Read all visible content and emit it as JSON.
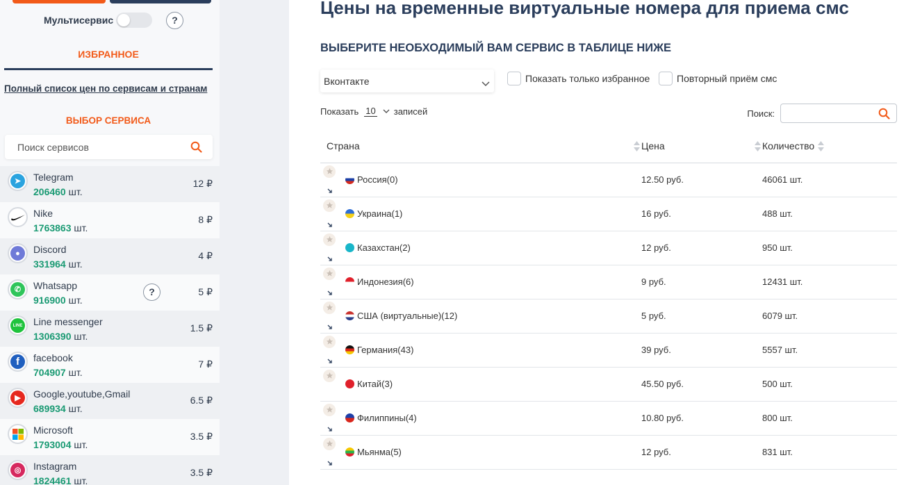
{
  "sidebar": {
    "multiservice_label": "Мультисервис",
    "help_mark": "?",
    "favorites_title": "ИЗБРАННОЕ",
    "full_list_link": "Полный список цен по сервисам и странам",
    "choose_service_title": "ВЫБОР СЕРВИСА",
    "search_placeholder": "Поиск сервисов",
    "services": [
      {
        "name": "Telegram",
        "count": "206460",
        "unit": "шт.",
        "price": "12 ₽",
        "icon": "telegram-icon",
        "color": "#2aa3df"
      },
      {
        "name": "Nike",
        "count": "1763863",
        "unit": "шт.",
        "price": "8 ₽",
        "icon": "nike-icon",
        "color": "#111111"
      },
      {
        "name": "Discord",
        "count": "331964",
        "unit": "шт.",
        "price": "4 ₽",
        "icon": "discord-icon",
        "color": "#6f7ad8"
      },
      {
        "name": "Whatsapp",
        "count": "916900",
        "unit": "шт.",
        "price": "5 ₽",
        "icon": "whatsapp-icon",
        "color": "#2fc55b",
        "help": "?"
      },
      {
        "name": "Line messenger",
        "count": "1306390",
        "unit": "шт.",
        "price": "1.5 ₽",
        "icon": "line-icon",
        "color": "#1fc33d"
      },
      {
        "name": "facebook",
        "count": "704907",
        "unit": "шт.",
        "price": "7 ₽",
        "icon": "facebook-icon",
        "color": "#1f5fbf"
      },
      {
        "name": "Google,youtube,Gmail",
        "count": "689934",
        "unit": "шт.",
        "price": "6.5 ₽",
        "icon": "youtube-icon",
        "color": "#e6281e"
      },
      {
        "name": "Microsoft",
        "count": "1793004",
        "unit": "шт.",
        "price": "3.5 ₽",
        "icon": "microsoft-icon",
        "color": "#ffffff"
      },
      {
        "name": "Instagram",
        "count": "1824461",
        "unit": "шт.",
        "price": "3.5 ₽",
        "icon": "instagram-icon",
        "color": "#d6295f"
      }
    ]
  },
  "main": {
    "title": "Цены на временные виртуальные номера для приема смс",
    "subtitle": "ВЫБЕРИТЕ НЕОБХОДИМЫЙ ВАМ СЕРВИС В ТАБЛИЦЕ НИЖЕ",
    "selected_service": "Вконтакте",
    "favorites_only_label": "Показать только избранное",
    "repeat_sms_label": "Повторный приём смс",
    "show_label": "Показать",
    "page_length": "10",
    "records_label": "записей",
    "search_label": "Поиск:",
    "search_value": "",
    "table": {
      "headers": [
        "Страна",
        "Цена",
        "Количество"
      ],
      "rows": [
        {
          "country": "Россия(0)",
          "price": "12.50 руб.",
          "qty": "46061 шт.",
          "flag": [
            "#ffffff",
            "#1c3fa6",
            "#d52b1e"
          ],
          "arrow": true
        },
        {
          "country": "Украина(1)",
          "price": "16 руб.",
          "qty": "488 шт.",
          "flag": [
            "#2f6fd6",
            "#f7d117"
          ],
          "arrow": true
        },
        {
          "country": "Казахстан(2)",
          "price": "12 руб.",
          "qty": "950 шт.",
          "flag": [
            "#19b6c9"
          ],
          "arrow": true
        },
        {
          "country": "Индонезия(6)",
          "price": "9 руб.",
          "qty": "12431 шт.",
          "flag": [
            "#e0202b",
            "#ffffff"
          ],
          "arrow": true
        },
        {
          "country": "США (виртуальные)(12)",
          "price": "5 руб.",
          "qty": "6079 шт.",
          "flag": [
            "#c9302c",
            "#ffffff",
            "#2b3f8a"
          ],
          "arrow": true
        },
        {
          "country": "Германия(43)",
          "price": "39 руб.",
          "qty": "5557 шт.",
          "flag": [
            "#111111",
            "#d9261c",
            "#f5c800"
          ],
          "arrow": true
        },
        {
          "country": "Китай(3)",
          "price": "45.50 руб.",
          "qty": "500 шт.",
          "flag": [
            "#e0202b"
          ],
          "arrow": false
        },
        {
          "country": "Филиппины(4)",
          "price": "10.80 руб.",
          "qty": "800 шт.",
          "flag": [
            "#1f3fa8",
            "#d9261c"
          ],
          "arrow": true
        },
        {
          "country": "Мьянма(5)",
          "price": "12 руб.",
          "qty": "831 шт.",
          "flag": [
            "#f5c800",
            "#2bb34a",
            "#e0202b"
          ],
          "arrow": true
        }
      ]
    }
  },
  "colors": {
    "accent_orange": "#f25a19",
    "navy": "#2b3e5c",
    "count_green": "#1a9a73"
  }
}
